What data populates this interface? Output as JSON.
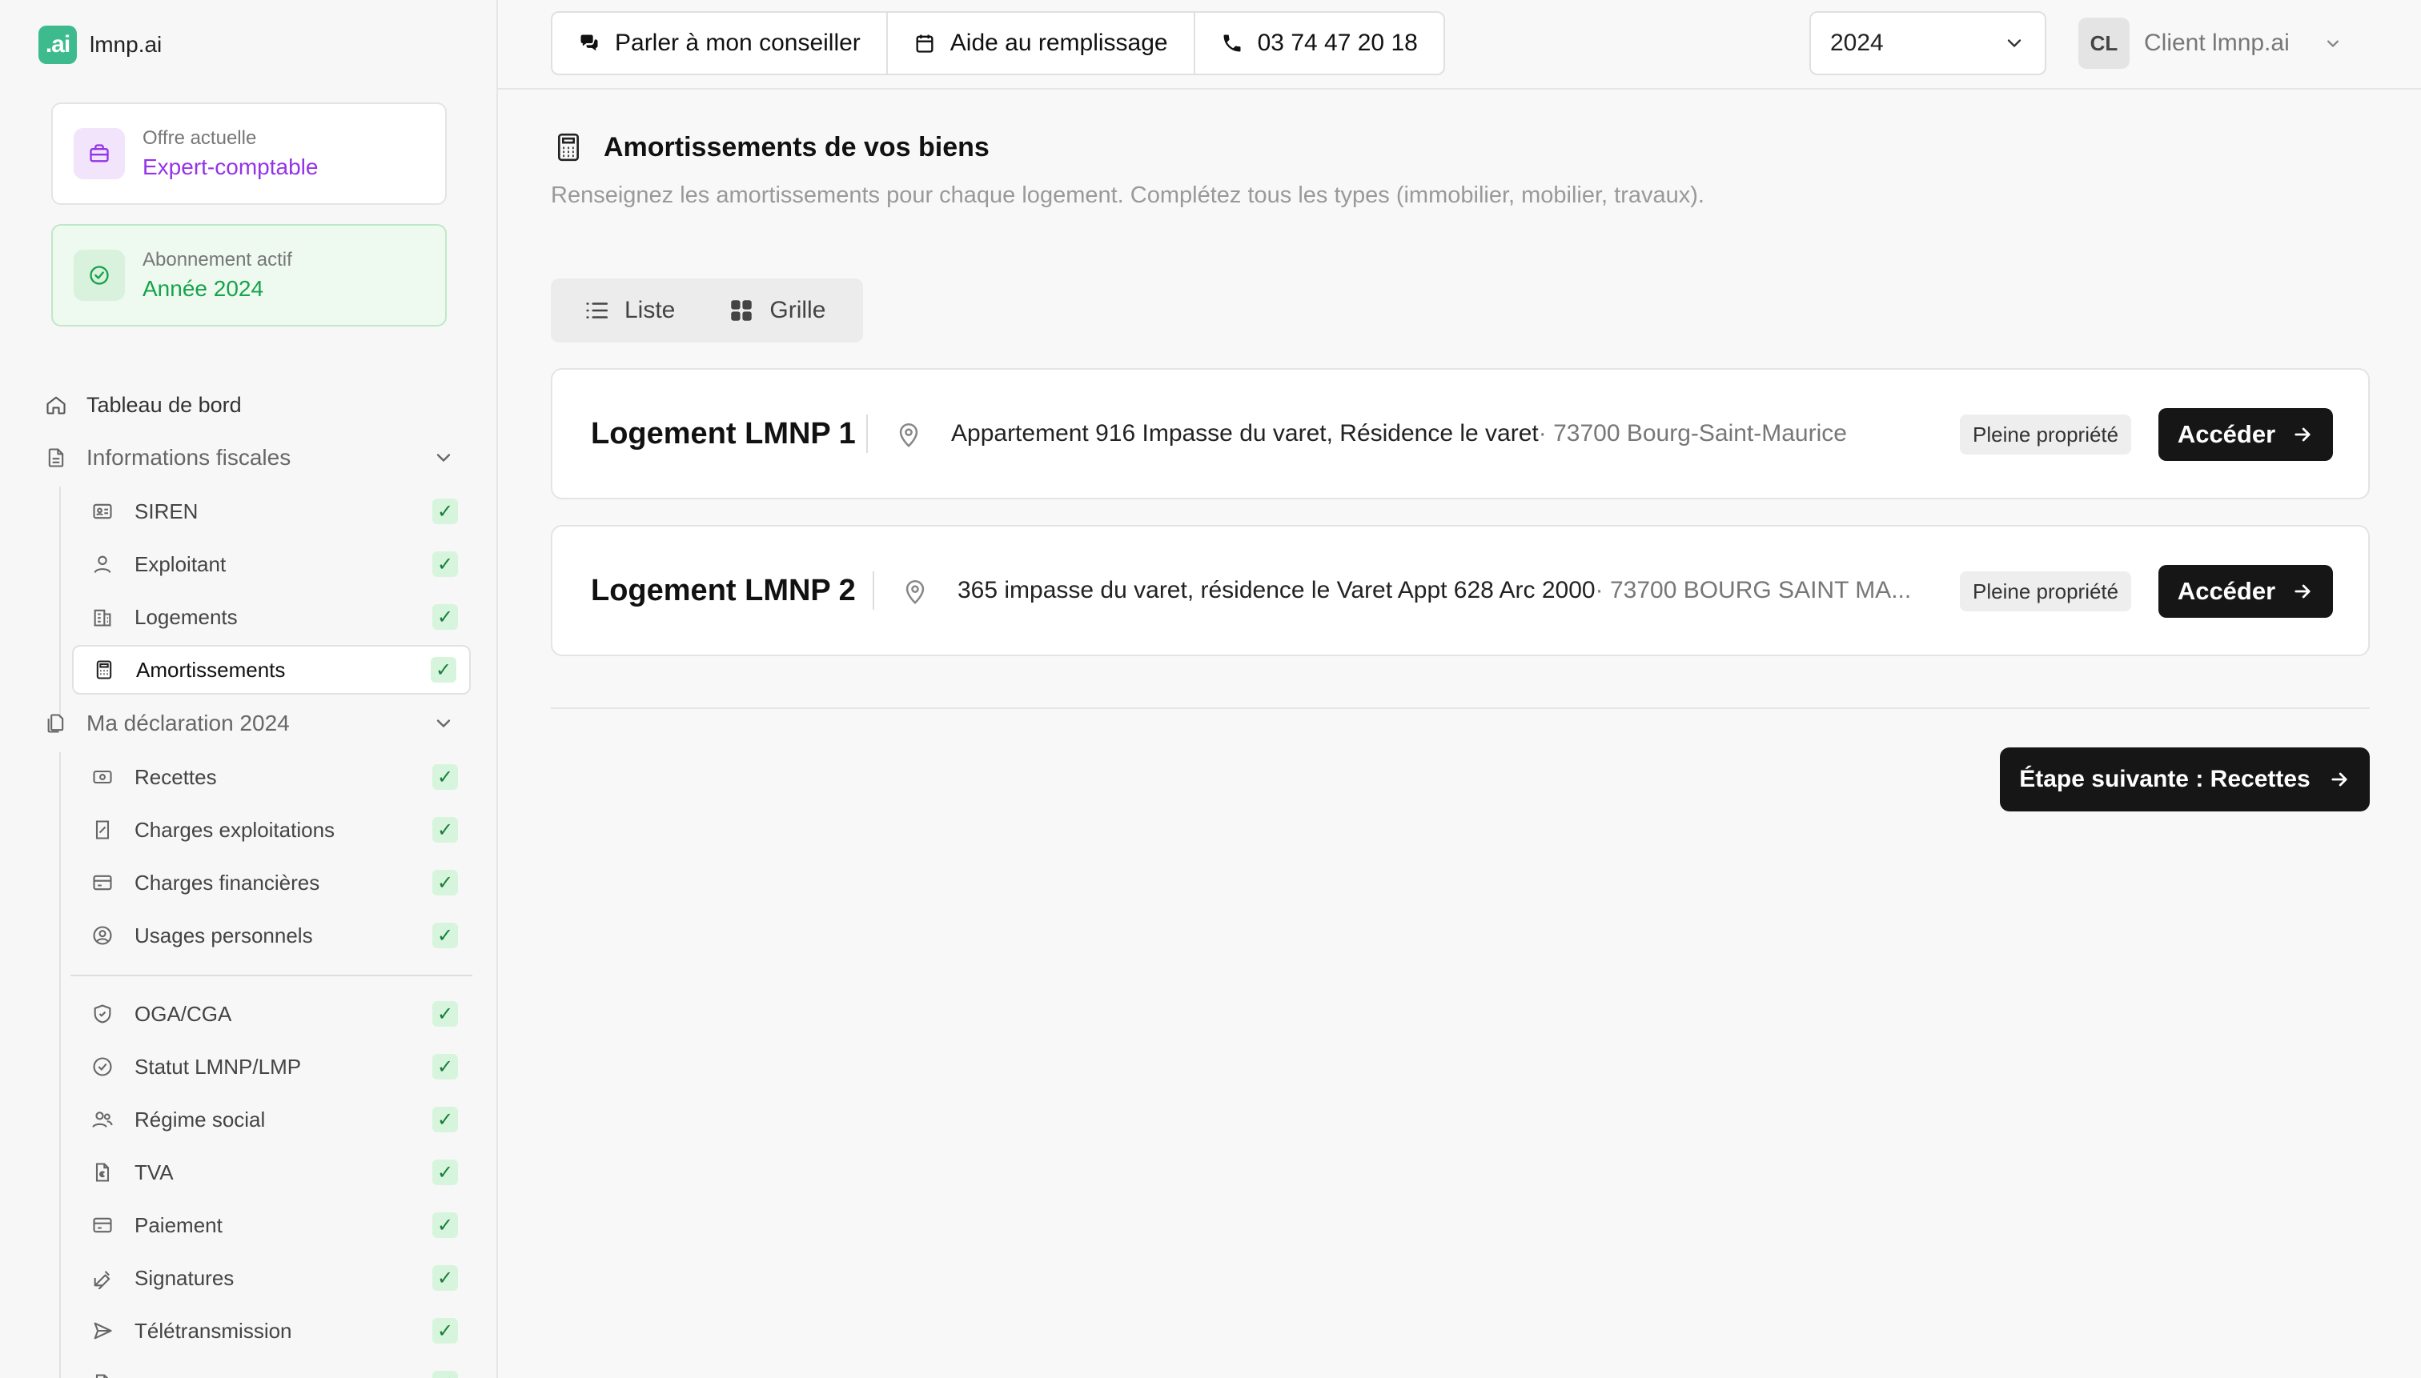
{
  "brand": {
    "logo_text": ".ai",
    "name": "lmnp.ai"
  },
  "plan": {
    "offer_label": "Offre actuelle",
    "offer_value": "Expert-comptable",
    "subscription_label": "Abonnement actif",
    "subscription_value": "Année 2024"
  },
  "nav": {
    "dashboard": "Tableau de bord",
    "fiscal_section": "Informations fiscales",
    "fiscal_items": [
      {
        "label": "SIREN",
        "icon": "id-card-icon",
        "done": true
      },
      {
        "label": "Exploitant",
        "icon": "user-icon",
        "done": true
      },
      {
        "label": "Logements",
        "icon": "building-icon",
        "done": true
      },
      {
        "label": "Amortissements",
        "icon": "calculator-icon",
        "done": true,
        "active": true
      }
    ],
    "declaration_section": "Ma déclaration 2024",
    "declaration_items": [
      {
        "label": "Recettes",
        "icon": "banknote-icon",
        "done": true
      },
      {
        "label": "Charges exploitations",
        "icon": "receipt-icon",
        "done": true
      },
      {
        "label": "Charges financières",
        "icon": "credit-card-icon",
        "done": true
      },
      {
        "label": "Usages personnels",
        "icon": "user-circle-icon",
        "done": true
      }
    ],
    "other_items": [
      {
        "label": "OGA/CGA",
        "icon": "shield-icon",
        "done": true
      },
      {
        "label": "Statut LMNP/LMP",
        "icon": "badge-check-icon",
        "done": true
      },
      {
        "label": "Régime social",
        "icon": "users-icon",
        "done": true
      },
      {
        "label": "TVA",
        "icon": "file-euro-icon",
        "done": true
      },
      {
        "label": "Paiement",
        "icon": "credit-card-icon",
        "done": true
      },
      {
        "label": "Signatures",
        "icon": "pen-icon",
        "done": true
      },
      {
        "label": "Télétransmission",
        "icon": "send-icon",
        "done": true
      }
    ],
    "check_glyph": "✓"
  },
  "topbar": {
    "advisor": "Parler à mon conseiller",
    "help": "Aide au remplissage",
    "phone": "03 74 47 20 18",
    "year": "2024",
    "user_initials": "CL",
    "user_name": "Client lmnp.ai"
  },
  "main": {
    "title": "Amortissements de vos biens",
    "subtitle": "Renseignez les amortissements pour chaque logement. Complétez tous les types (immobilier, mobilier, travaux).",
    "view_list": "Liste",
    "view_grid": "Grille",
    "lodgings": [
      {
        "name": "Logement LMNP 1",
        "address": "Appartement 916 Impasse du varet, Résidence le varet",
        "city": " · 73700 Bourg-Saint-Maurice",
        "ownership": "Pleine propriété",
        "action": "Accéder"
      },
      {
        "name": "Logement LMNP 2",
        "address": "365 impasse du varet, résidence le Varet Appt 628 Arc 2000",
        "city": " · 73700 BOURG SAINT MA...",
        "ownership": "Pleine propriété",
        "action": "Accéder"
      }
    ],
    "next_step": "Étape suivante : Recettes"
  },
  "colors": {
    "accent_dark": "#161616",
    "brand_green": "#3dbb8f",
    "offer_purple": "#9333ea",
    "success_green": "#16a34a"
  }
}
